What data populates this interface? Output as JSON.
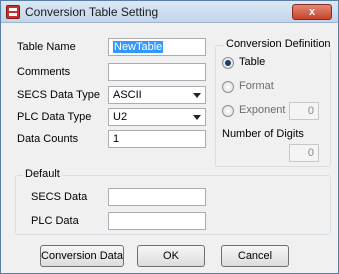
{
  "window": {
    "title": "Conversion Table Setting",
    "close_glyph": "x"
  },
  "fields": {
    "table_name": {
      "label": "Table Name",
      "value": "NewTable"
    },
    "comments": {
      "label": "Comments",
      "value": ""
    },
    "secs_data_type": {
      "label": "SECS Data Type",
      "value": "ASCII"
    },
    "plc_data_type": {
      "label": "PLC Data Type",
      "value": "U2"
    },
    "data_counts": {
      "label": "Data Counts",
      "value": "1"
    }
  },
  "conversion_definition": {
    "title": "Conversion Definition",
    "options": [
      {
        "label": "Table",
        "checked": true
      },
      {
        "label": "Format",
        "checked": false
      },
      {
        "label": "Exponent",
        "checked": false
      }
    ],
    "exponent_value": "0",
    "number_of_digits_label": "Number of Digits",
    "number_of_digits_value": "0"
  },
  "default": {
    "title": "Default",
    "secs_data_label": "SECS Data",
    "secs_data_value": "",
    "plc_data_label": "PLC Data",
    "plc_data_value": ""
  },
  "buttons": {
    "conversion_data": "Conversion Data",
    "ok": "OK",
    "cancel": "Cancel"
  }
}
